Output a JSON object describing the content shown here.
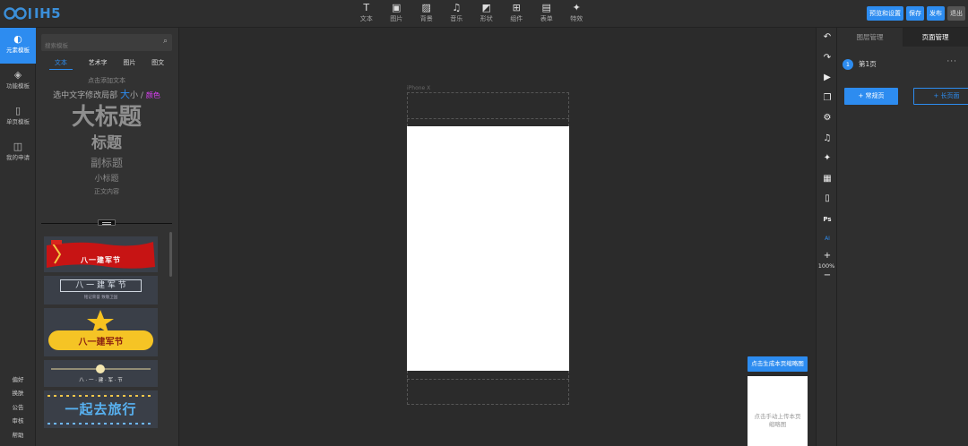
{
  "logo": "IH5",
  "toolbar": {
    "items": [
      {
        "icon": "text-icon",
        "glyph": "T",
        "label": "文本"
      },
      {
        "icon": "image-icon",
        "glyph": "▣",
        "label": "图片"
      },
      {
        "icon": "background-icon",
        "glyph": "▨",
        "label": "背景"
      },
      {
        "icon": "music-icon",
        "glyph": "♫",
        "label": "音乐"
      },
      {
        "icon": "shape-icon",
        "glyph": "◩",
        "label": "形状"
      },
      {
        "icon": "component-icon",
        "glyph": "⊞",
        "label": "组件"
      },
      {
        "icon": "form-icon",
        "glyph": "▤",
        "label": "表单"
      },
      {
        "icon": "effects-icon",
        "glyph": "✦",
        "label": "特效"
      }
    ],
    "actions": {
      "preview": "预览和设置",
      "save": "保存",
      "publish": "发布",
      "exit": "退出"
    }
  },
  "rail": {
    "items": [
      {
        "label": "元素模板",
        "glyph": "◐",
        "active": true
      },
      {
        "label": "功能模板",
        "glyph": "◈",
        "active": false
      },
      {
        "label": "单页模板",
        "glyph": "▯",
        "active": false
      },
      {
        "label": "我的申请",
        "glyph": "◫",
        "active": false
      }
    ],
    "bottom": [
      "偏好",
      "换肤",
      "公告",
      "审核",
      "帮助"
    ]
  },
  "panel": {
    "search_placeholder": "搜索模板",
    "tabs": [
      "文本",
      "艺术字",
      "图片",
      "图文"
    ],
    "active_tab": 0,
    "presets": {
      "hint": "点击添加文本",
      "mix_a": "选中文字修改局部",
      "mix_big": "大",
      "mix_small": "小",
      "mix_sep": "/",
      "mix_color": "颜色",
      "h1": "大标题",
      "h2": "标题",
      "h3": "副标题",
      "h4": "小标题",
      "body": "正文内容"
    },
    "templates": [
      {
        "text": "八一建军节",
        "style": "red-banner"
      },
      {
        "text": "八 一 建 军 节",
        "sub": "铭记荣誉   致敬卫国",
        "style": "framed"
      },
      {
        "text": "八一建军节",
        "style": "yellow-star"
      },
      {
        "text": "八 · 一 · 建 · 军 · 节",
        "style": "line-dot"
      },
      {
        "text": "一起去旅行",
        "style": "travel"
      }
    ]
  },
  "canvas": {
    "device_label": "iPhone X",
    "preview_button": "点击生成本页缩略图",
    "preview_hint": "点击手动上传本页缩略图"
  },
  "right_tools": {
    "items": [
      {
        "name": "undo-icon",
        "glyph": "↶"
      },
      {
        "name": "redo-icon",
        "glyph": "↷"
      },
      {
        "name": "play-icon",
        "glyph": "▶"
      },
      {
        "name": "copy-icon",
        "glyph": "❐"
      },
      {
        "name": "settings-icon",
        "glyph": "⚙"
      },
      {
        "name": "music-icon",
        "glyph": "♫"
      },
      {
        "name": "effects-icon",
        "glyph": "✦"
      },
      {
        "name": "grid-icon",
        "glyph": "▦"
      },
      {
        "name": "mobile-icon",
        "glyph": "▯"
      },
      {
        "name": "ps-icon",
        "glyph": "Ps"
      },
      {
        "name": "ai-icon",
        "glyph": "AI"
      }
    ],
    "zoom_in": "+",
    "zoom": "100%",
    "zoom_out": "−"
  },
  "right_panel": {
    "tabs": [
      "图层管理",
      "页面管理"
    ],
    "active_tab": 1,
    "page": {
      "number": "1",
      "name": "第1页",
      "more": "···"
    },
    "add_normal": "+ 常规页",
    "add_long": "+ 长页面"
  },
  "colors": {
    "accent": "#2d8cf0",
    "bg": "#2b2b2b",
    "panel": "#323232"
  }
}
